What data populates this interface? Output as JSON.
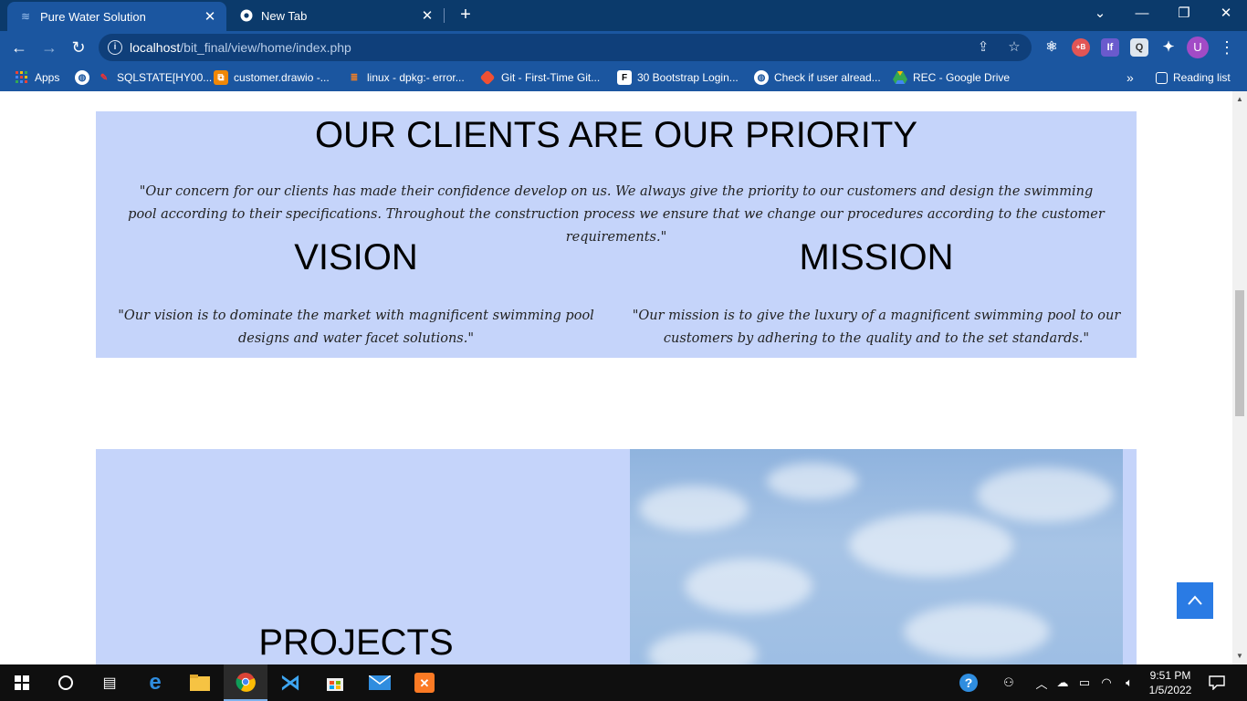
{
  "browser": {
    "tabs": [
      {
        "title": "Pure Water Solution",
        "active": true
      },
      {
        "title": "New Tab",
        "active": false
      }
    ],
    "url_host": "localhost",
    "url_path": "/bit_final/view/home/index.php",
    "bookmarks": [
      {
        "label": "Apps",
        "icon": "apps-grid-icon"
      },
      {
        "label": "",
        "icon": "globe-icon"
      },
      {
        "label": "SQLSTATE[HY00...",
        "icon": "pencil-icon"
      },
      {
        "label": "customer.drawio -...",
        "icon": "drawio-icon"
      },
      {
        "label": "linux - dpkg:- error...",
        "icon": "stackoverflow-icon"
      },
      {
        "label": "Git - First-Time Git...",
        "icon": "git-icon"
      },
      {
        "label": "30 Bootstrap Login...",
        "icon": "f-icon"
      },
      {
        "label": "Check if user alread...",
        "icon": "globe-icon"
      },
      {
        "label": "REC - Google Drive",
        "icon": "google-drive-icon"
      }
    ],
    "reading_list": "Reading list",
    "avatar_letter": "U"
  },
  "page": {
    "priority_heading": "OUR CLIENTS ARE OUR PRIORITY",
    "priority_quote": "\"Our concern for our clients has made their confidence develop on us. We always give the priority to our customers and design the swimming pool according to their specifications. Throughout the construction process we ensure that we change our procedures according to the customer requirements.\"",
    "vision_heading": "VISION",
    "vision_text": "\"Our vision is to dominate the market with magnificent swimming pool designs and water facet solutions.\"",
    "mission_heading": "MISSION",
    "mission_text": "\"Our mission is to give the luxury of a magnificent swimming pool to our customers by adhering to the quality and to the set standards.\"",
    "projects_heading": "PROJECTS"
  },
  "taskbar": {
    "time": "9:51 PM",
    "date": "1/5/2022"
  },
  "colors": {
    "section_bg": "#c5d4fa",
    "chrome_bg": "#1b56a0",
    "scroll_top_button": "#2a7be4"
  }
}
